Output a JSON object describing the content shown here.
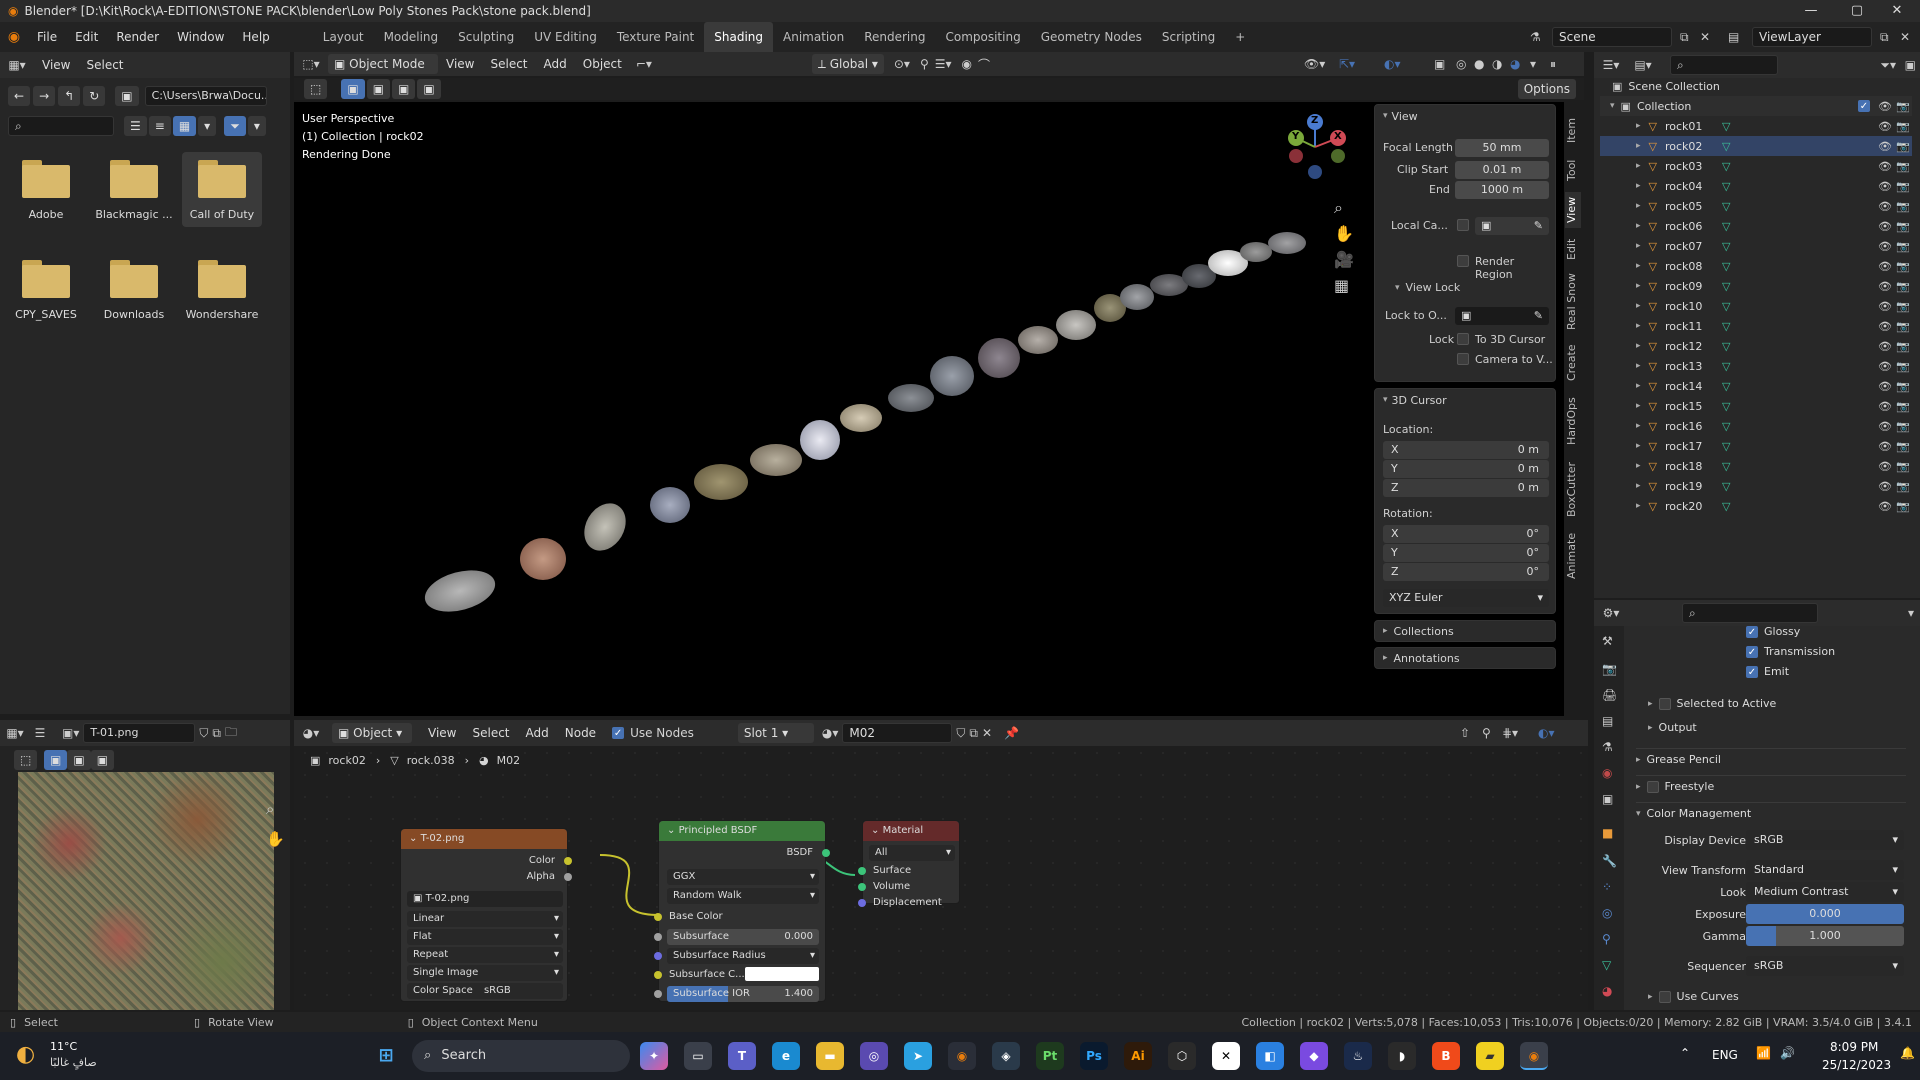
{
  "window": {
    "title": "Blender* [D:\\Kit\\Rock\\A-EDITION\\STONE PACK\\blender\\Low Poly Stones Pack\\stone pack.blend]"
  },
  "menu": {
    "items": [
      "File",
      "Edit",
      "Render",
      "Window",
      "Help"
    ]
  },
  "workspaces": [
    "Layout",
    "Modeling",
    "Sculpting",
    "UV Editing",
    "Texture Paint",
    "Shading",
    "Animation",
    "Rendering",
    "Compositing",
    "Geometry Nodes",
    "Scripting"
  ],
  "active_workspace": "Shading",
  "scene": {
    "name": "Scene",
    "view_layer": "ViewLayer"
  },
  "filebrowser": {
    "menus": [
      "View",
      "Select"
    ],
    "path": "C:\\Users\\Brwa\\Docu...",
    "folders": [
      "Adobe",
      "Blackmagic ...",
      "Call of Duty",
      "CPY_SAVES",
      "Downloads",
      "Wondershare"
    ]
  },
  "viewport": {
    "mode": "Object Mode",
    "menus": [
      "View",
      "Select",
      "Add",
      "Object"
    ],
    "orientation": "Global",
    "options": "Options",
    "info": [
      "User Perspective",
      "(1) Collection | rock02",
      "Rendering Done"
    ],
    "gizmo": {
      "x": "X",
      "y": "Y",
      "z": "Z"
    }
  },
  "npanel": {
    "view_title": "View",
    "focal_length_label": "Focal Length",
    "focal_length": "50 mm",
    "clip_start_label": "Clip Start",
    "clip_start": "0.01 m",
    "end_label": "End",
    "end": "1000 m",
    "local_camera_label": "Local Ca...",
    "render_region": "Render Region",
    "view_lock_title": "View Lock",
    "lock_to_object_label": "Lock to O...",
    "lock_label": "Lock",
    "to_3d_cursor": "To 3D Cursor",
    "camera_to_view": "Camera to V...",
    "cursor_title": "3D Cursor",
    "location_label": "Location:",
    "loc": {
      "x": "0 m",
      "y": "0 m",
      "z": "0 m"
    },
    "rotation_label": "Rotation:",
    "rot": {
      "x": "0°",
      "y": "0°",
      "z": "0°"
    },
    "axis": {
      "x": "X",
      "y": "Y",
      "z": "Z"
    },
    "rotation_mode": "XYZ Euler",
    "collections": "Collections",
    "annotations": "Annotations",
    "tabs": [
      "Item",
      "Tool",
      "View",
      "Edit",
      "Real Snow",
      "Create",
      "HardOps",
      "BoxCutter",
      "Animate"
    ]
  },
  "outliner": {
    "scene_collection": "Scene Collection",
    "collection": "Collection",
    "objects": [
      "rock01",
      "rock02",
      "rock03",
      "rock04",
      "rock05",
      "rock06",
      "rock07",
      "rock08",
      "rock09",
      "rock10",
      "rock11",
      "rock12",
      "rock13",
      "rock14",
      "rock15",
      "rock16",
      "rock17",
      "rock18",
      "rock19",
      "rock20"
    ]
  },
  "image_editor": {
    "image_name": "T-01.png"
  },
  "node_editor": {
    "object": "Object",
    "menus": [
      "View",
      "Select",
      "Add",
      "Node"
    ],
    "use_nodes": "Use Nodes",
    "slot": "Slot 1",
    "material": "M02",
    "breadcrumb": [
      "rock02",
      "rock.038",
      "M02"
    ],
    "image_node": {
      "title": "T-02.png",
      "color": "Color",
      "alpha": "Alpha",
      "image": "T-02.png",
      "interpolation": "Linear",
      "projection": "Flat",
      "extension": "Repeat",
      "source": "Single Image",
      "color_space_label": "Color Space",
      "color_space": "sRGB"
    },
    "bsdf_node": {
      "title": "Principled BSDF",
      "out": "BSDF",
      "distribution": "GGX",
      "subsurface_method": "Random Walk",
      "base_color": "Base Color",
      "subsurface": "Subsurface",
      "subsurface_value": "0.000",
      "subsurface_radius": "Subsurface Radius",
      "subsurface_color": "Subsurface C...",
      "subsurface_ior": "Subsurface IOR",
      "subsurface_ior_value": "1.400"
    },
    "output_node": {
      "title": "Material Output",
      "target": "All",
      "surface": "Surface",
      "volume": "Volume",
      "displacement": "Displacement"
    }
  },
  "properties": {
    "glossy": "Glossy",
    "transmission": "Transmission",
    "emit": "Emit",
    "selected_to_active": "Selected to Active",
    "output": "Output",
    "grease_pencil": "Grease Pencil",
    "freestyle": "Freestyle",
    "color_management": "Color Management",
    "display_device_label": "Display Device",
    "display_device": "sRGB",
    "view_transform_label": "View Transform",
    "view_transform": "Standard",
    "look_label": "Look",
    "look": "Medium Contrast",
    "exposure_label": "Exposure",
    "exposure": "0.000",
    "gamma_label": "Gamma",
    "gamma": "1.000",
    "sequencer_label": "Sequencer",
    "sequencer": "sRGB",
    "use_curves": "Use Curves"
  },
  "statusbar": {
    "select": "Select",
    "rotate": "Rotate View",
    "context": "Object Context Menu",
    "stats": "Collection | rock02 | Verts:5,078 | Faces:10,053 | Tris:10,076 | Objects:0/20 | Memory: 2.82 GiB | VRAM: 3.5/4.0 GiB | 3.4.1"
  },
  "taskbar": {
    "temp": "11°C",
    "weather": "صافٍ غالبًا",
    "search": "Search",
    "lang": "ENG",
    "time": "8:09 PM",
    "date": "25/12/2023"
  }
}
